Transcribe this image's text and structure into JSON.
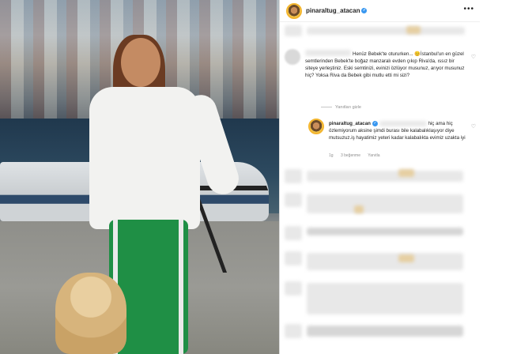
{
  "post": {
    "username": "pinaraltug_atacan",
    "more_label": "•••"
  },
  "comment": {
    "text": "Henüz Bebek'te oturur­ken... 😊İstanbul'un en güzel semtlerinden Bebek'te boğaz manzaralı evden çıkıp Riva'da, ıssız bir siteye yerleştiniz. Eski semtinizi, evinizi özlüyor musunuz, arıyor musunuz hiç? Yoksa Riva da Bebek gibi mutlu etti mi sizi?",
    "hide_replies": "Yanıtları gizle"
  },
  "reply": {
    "username": "pinaraltug_atacan",
    "text": "hiç ama hiç özlemiyorum aksine şimdi burası bile kalabalıklaşıyor diye mutsuzuz.iş hayatimiz yeteri kadar kalabalıkta evimiz uzakta iyi",
    "time": "1g",
    "likes": "3 beğenme",
    "reply_label": "Yanıtla"
  },
  "icons": {
    "verified": "✓",
    "heart": "♡"
  }
}
